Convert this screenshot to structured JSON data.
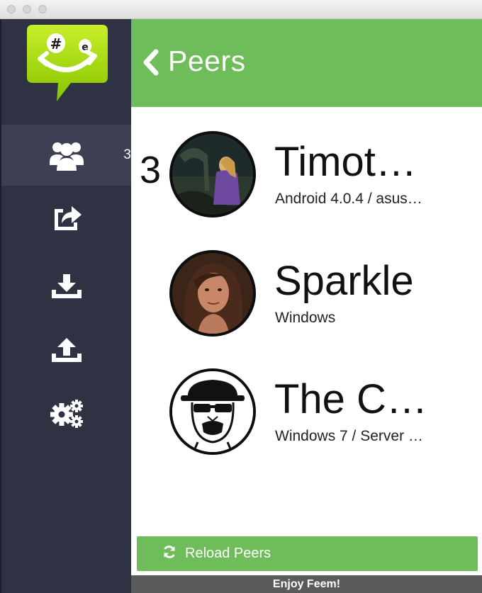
{
  "window": {
    "controls": [
      "close",
      "minimize",
      "zoom"
    ]
  },
  "app": {
    "logo_icon": "feem-smiley-logo-icon"
  },
  "sidebar": {
    "items": [
      {
        "icon": "users-icon",
        "badge": "3",
        "active": true
      },
      {
        "icon": "share-icon",
        "active": false
      },
      {
        "icon": "download-icon",
        "active": false
      },
      {
        "icon": "upload-icon",
        "active": false
      },
      {
        "icon": "settings-icon",
        "active": false
      }
    ]
  },
  "header": {
    "back_icon": "chevron-left-icon",
    "title": "Peers"
  },
  "peers": [
    {
      "count": "3",
      "name": "Timot…",
      "os": "Android 4.0.4 / asus…"
    },
    {
      "name": "Sparkle",
      "os": "Windows"
    },
    {
      "name": "The C…",
      "os": "Windows 7 / Server …"
    }
  ],
  "reload": {
    "icon": "refresh-icon",
    "label": "Reload Peers"
  },
  "footer": {
    "text": "Enjoy Feem!"
  },
  "colors": {
    "accent": "#6fbd5a",
    "sidebar": "#2f3242",
    "sidebar_active": "#3d4053",
    "logo": "#9bd000"
  }
}
